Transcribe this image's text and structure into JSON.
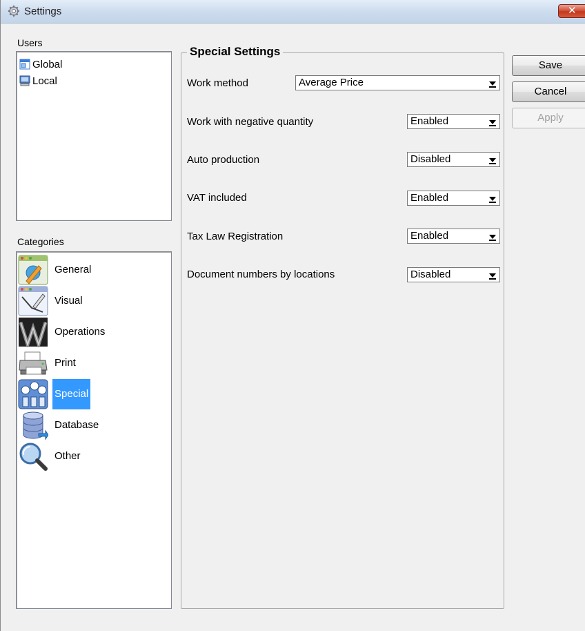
{
  "window": {
    "title": "Settings"
  },
  "users": {
    "label": "Users",
    "items": [
      {
        "label": "Global",
        "icon": "global-window-icon"
      },
      {
        "label": "Local",
        "icon": "computer-icon"
      }
    ]
  },
  "categories": {
    "label": "Categories",
    "selected": "Special",
    "items": [
      {
        "label": "General",
        "icon": "general-icon"
      },
      {
        "label": "Visual",
        "icon": "visual-icon"
      },
      {
        "label": "Operations",
        "icon": "operations-icon"
      },
      {
        "label": "Print",
        "icon": "printer-icon"
      },
      {
        "label": "Special",
        "icon": "gauges-icon"
      },
      {
        "label": "Database",
        "icon": "database-icon"
      },
      {
        "label": "Other",
        "icon": "magnifier-icon"
      }
    ]
  },
  "special_settings": {
    "title": "Special Settings",
    "rows": [
      {
        "label": "Work method",
        "value": "Average Price"
      },
      {
        "label": "Work with negative quantity",
        "value": "Enabled"
      },
      {
        "label": "Auto production",
        "value": "Disabled"
      },
      {
        "label": "VAT included",
        "value": "Enabled"
      },
      {
        "label": "Tax Law Registration",
        "value": "Enabled"
      },
      {
        "label": "Document numbers by locations",
        "value": "Disabled"
      }
    ]
  },
  "buttons": {
    "save": "Save",
    "cancel": "Cancel",
    "apply": "Apply"
  },
  "colors": {
    "selection": "#3399ff",
    "close_button": "#c7452b"
  }
}
